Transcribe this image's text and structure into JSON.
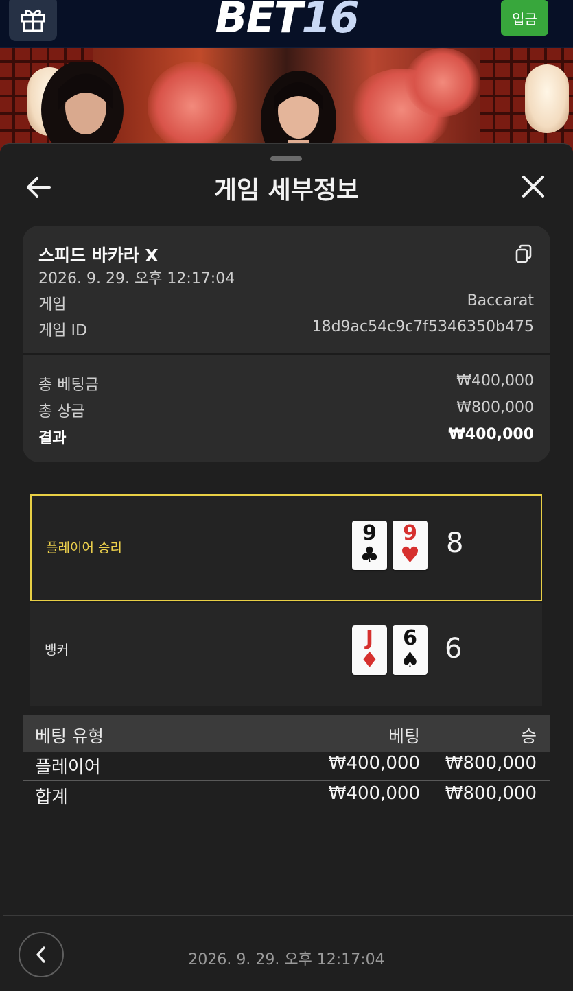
{
  "header": {
    "logo_part1": "BET",
    "logo_part2": "16",
    "deposit_label": "입금",
    "gift_icon": "gift-icon"
  },
  "sheet": {
    "title": "게임 세부정보",
    "back_icon": "arrow-left-icon",
    "close_icon": "close-icon"
  },
  "details": {
    "game_name": "스피드 바카라 X",
    "datetime": "2026. 9. 29. 오후 12:17:04",
    "copy_icon": "copy-icon",
    "rows": [
      {
        "label": "게임",
        "value": "Baccarat"
      },
      {
        "label": "게임 ID",
        "value": "18d9ac54c9c7f5346350b475"
      }
    ],
    "totals": [
      {
        "label": "총 베팅금",
        "value": "₩400,000"
      },
      {
        "label": "총 상금",
        "value": "₩800,000"
      },
      {
        "label": "결과",
        "value": "₩400,000"
      }
    ]
  },
  "hands": {
    "player": {
      "label": "플레이어 승리",
      "cards": [
        {
          "rank": "9",
          "suit": "♣",
          "color": "black"
        },
        {
          "rank": "9",
          "suit": "♥",
          "color": "red"
        }
      ],
      "score": "8"
    },
    "banker": {
      "label": "뱅커",
      "cards": [
        {
          "rank": "J",
          "suit": "♦",
          "color": "red"
        },
        {
          "rank": "6",
          "suit": "♠",
          "color": "black"
        }
      ],
      "score": "6"
    }
  },
  "bets": {
    "columns": [
      "베팅 유형",
      "베팅",
      "승"
    ],
    "rows": [
      [
        "플레이어",
        "₩400,000",
        "₩800,000"
      ],
      [
        "합계",
        "₩400,000",
        "₩800,000"
      ]
    ]
  },
  "footer": {
    "datetime": "2026. 9. 29. 오후 12:17:04",
    "back_icon": "chevron-left-icon"
  },
  "colors": {
    "header_bg": "#071026",
    "deposit_green": "#38a73c",
    "winner_gold": "#e8cf45",
    "card_bg": "#2c2c2c"
  }
}
